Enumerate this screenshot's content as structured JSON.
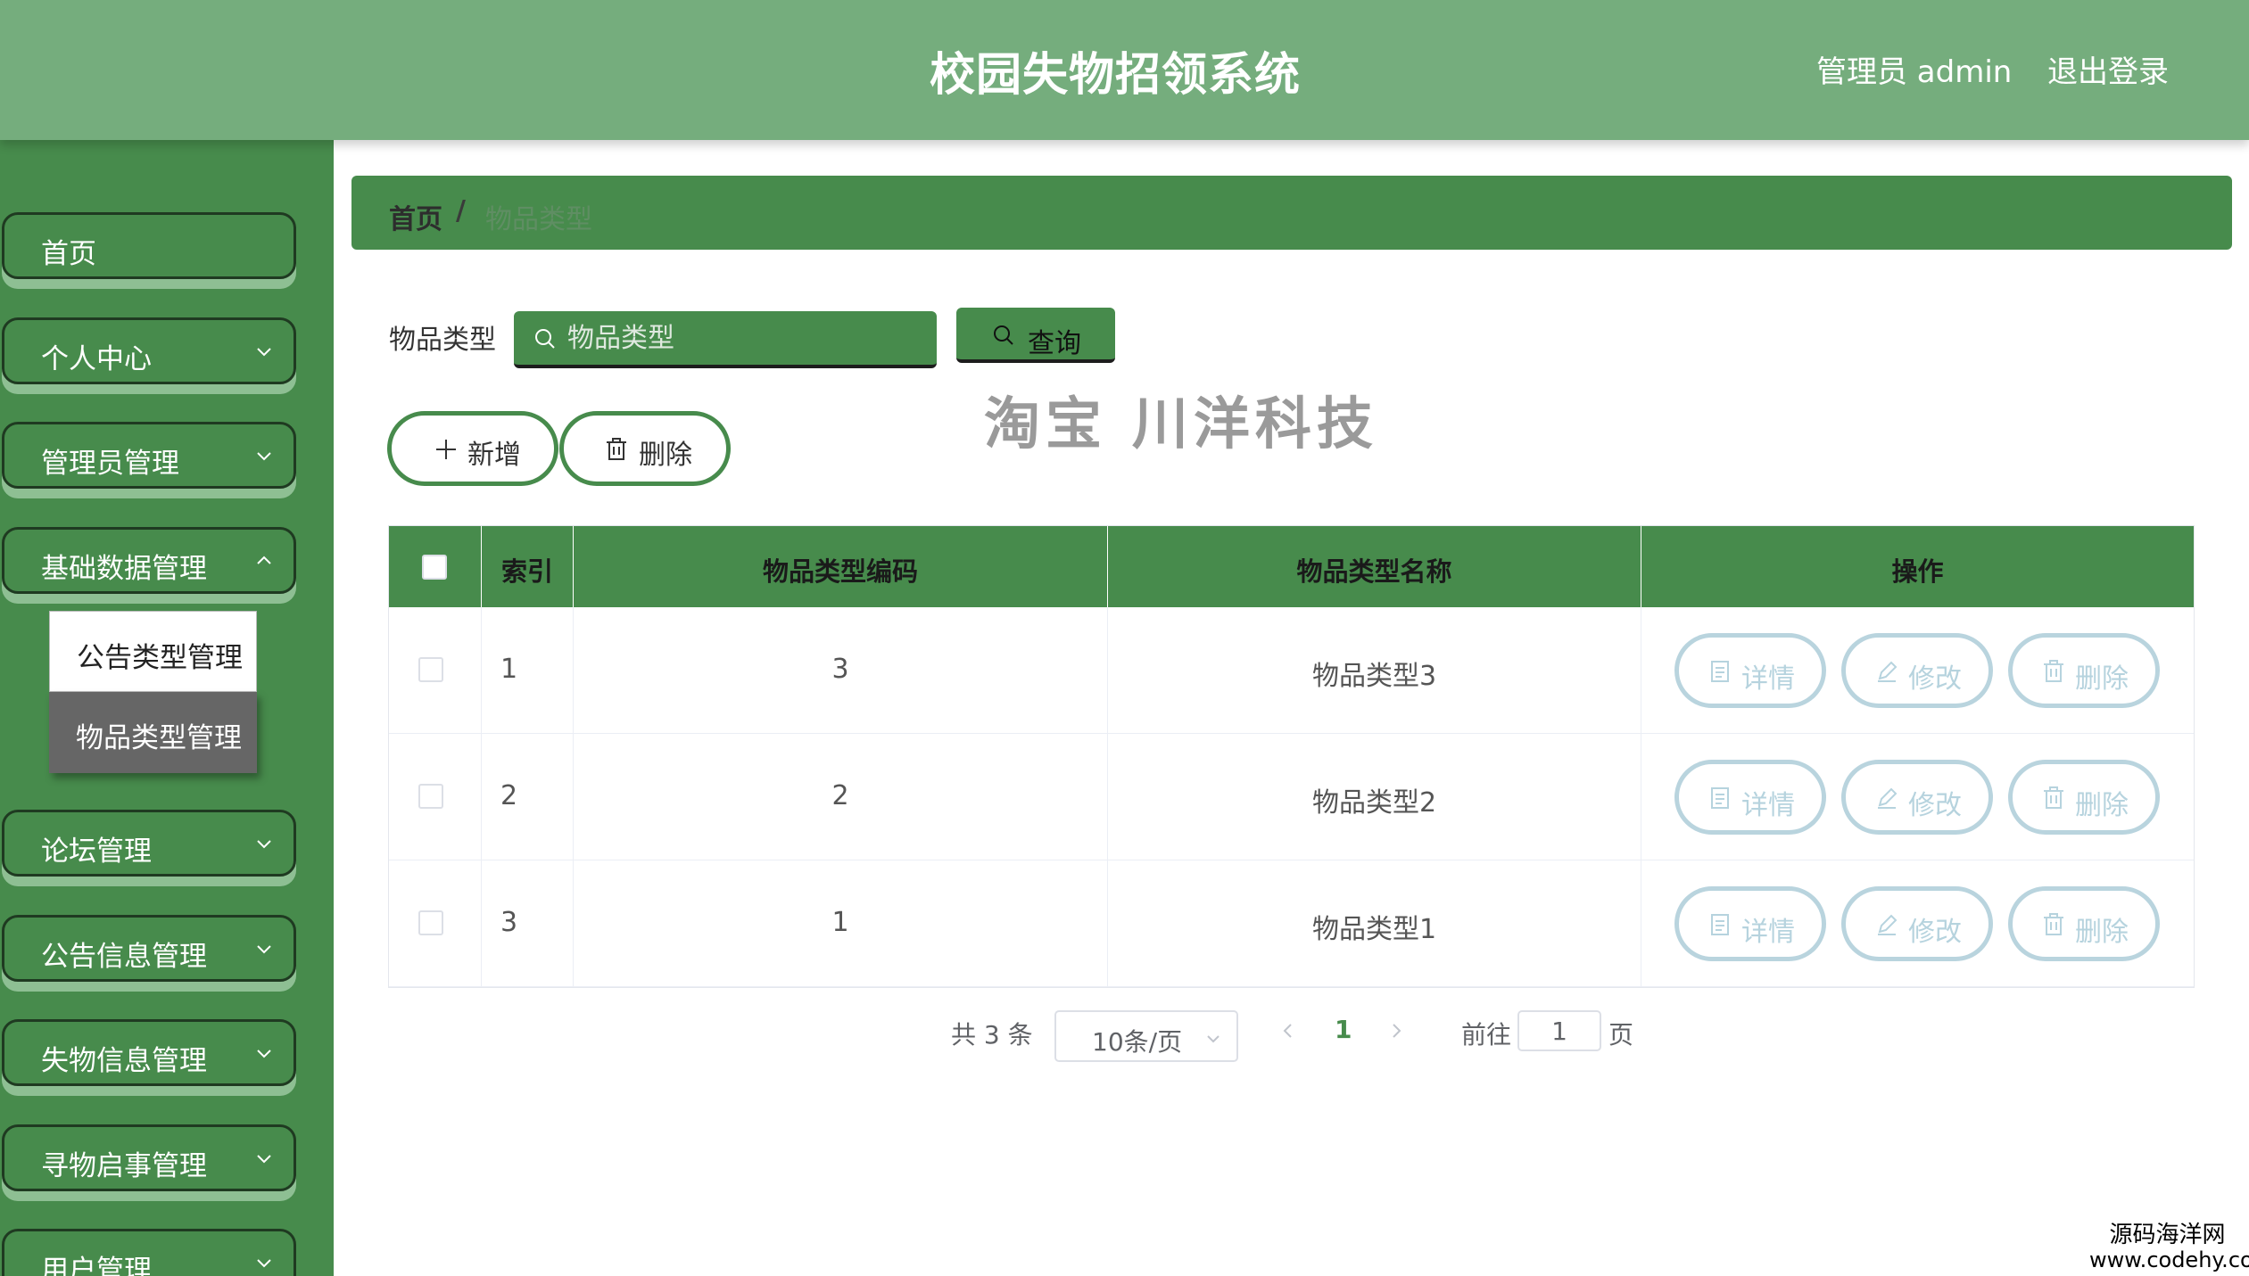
{
  "header": {
    "title": "校园失物招领系统",
    "user": "管理员 admin",
    "logout": "退出登录"
  },
  "sidebar": {
    "items": [
      {
        "label": "首页"
      },
      {
        "label": "个人中心"
      },
      {
        "label": "管理员管理"
      },
      {
        "label": "基础数据管理"
      },
      {
        "label": "论坛管理"
      },
      {
        "label": "公告信息管理"
      },
      {
        "label": "失物信息管理"
      },
      {
        "label": "寻物启事管理"
      },
      {
        "label": "用户管理"
      }
    ],
    "submenu": [
      {
        "label": "公告类型管理"
      },
      {
        "label": "物品类型管理"
      }
    ]
  },
  "breadcrumb": {
    "home": "首页",
    "separator": "/",
    "current": "物品类型"
  },
  "search": {
    "label": "物品类型",
    "placeholder": "物品类型",
    "button": "查询"
  },
  "watermark": "淘宝 川洋科技",
  "actions": {
    "add": "新增",
    "delete": "删除"
  },
  "table": {
    "columns": [
      "索引",
      "物品类型编码",
      "物品类型名称",
      "操作"
    ],
    "rows": [
      {
        "index": "1",
        "code": "3",
        "name": "物品类型3"
      },
      {
        "index": "2",
        "code": "2",
        "name": "物品类型2"
      },
      {
        "index": "3",
        "code": "1",
        "name": "物品类型1"
      }
    ],
    "row_actions": {
      "detail": "详情",
      "edit": "修改",
      "delete": "删除"
    }
  },
  "pagination": {
    "total": "共 3 条",
    "page_size": "10条/页",
    "current_page": "1",
    "goto_label": "前往",
    "goto_value": "1",
    "page_unit": "页"
  },
  "corner_mark": {
    "line1": "源码海洋网",
    "line2": "www.codehy.com"
  },
  "colors": {
    "header": "#75ad7d",
    "primary": "#478b4c",
    "op_button": "#b9d4de"
  }
}
